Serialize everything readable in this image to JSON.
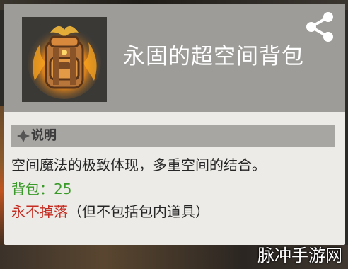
{
  "item": {
    "name": "永固的超空间背包",
    "icon": "glowing-backpack-icon",
    "rarity_color": "#f0a020"
  },
  "share": {
    "icon": "share-icon"
  },
  "section": {
    "label": "说明",
    "icon": "diamond-bullet-icon"
  },
  "description": "空间魔法的极致体现，多重空间的结合。",
  "stat": {
    "text": "背包：25",
    "color": "#3a9a29"
  },
  "binding": {
    "label": "永不掉落",
    "note": "（但不包括包内道具）",
    "color": "#c62d22"
  },
  "watermark": "脉冲手游网"
}
